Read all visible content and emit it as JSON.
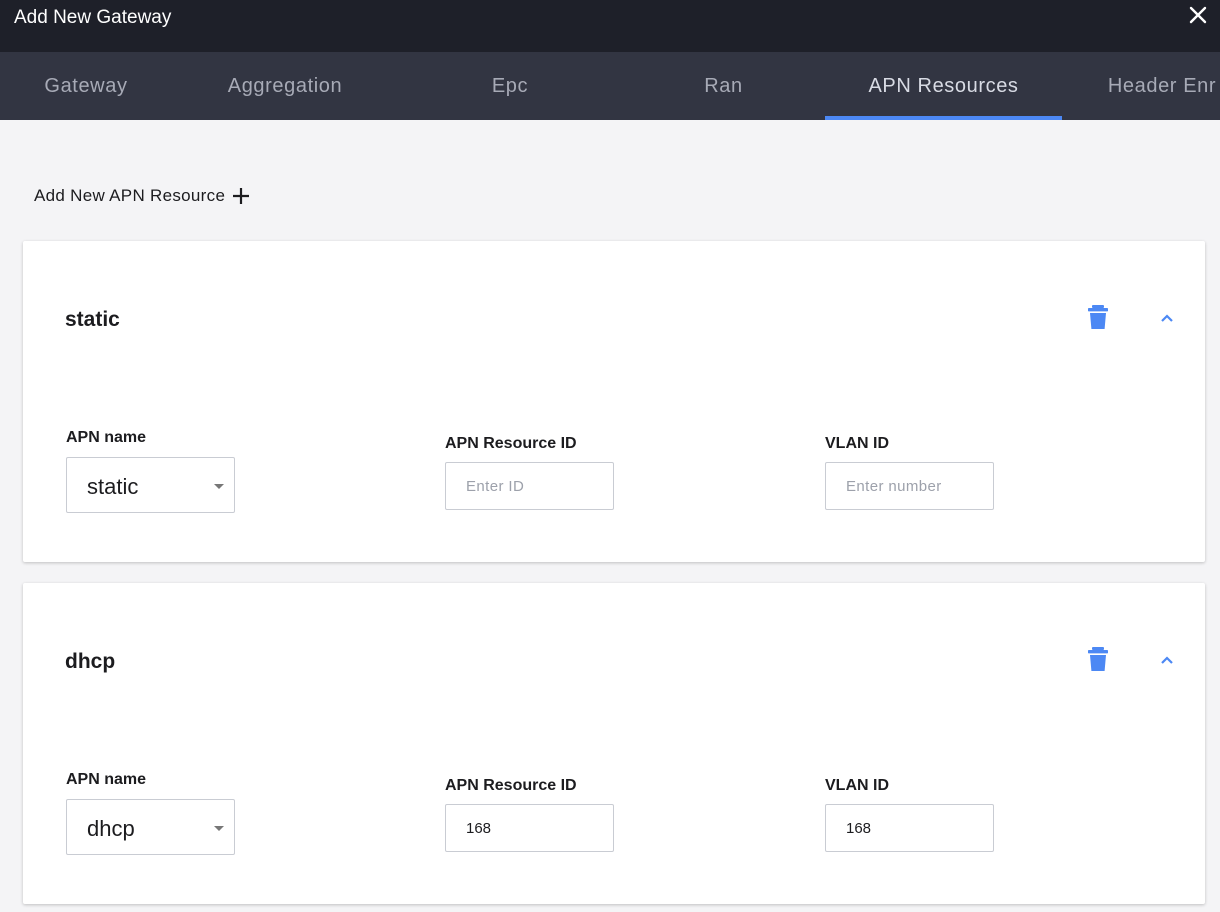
{
  "dialog": {
    "title": "Add New Gateway",
    "close_icon": "close-icon"
  },
  "tabs": [
    {
      "label": "Gateway",
      "active": false
    },
    {
      "label": "Aggregation",
      "active": false
    },
    {
      "label": "Epc",
      "active": false
    },
    {
      "label": "Ran",
      "active": false
    },
    {
      "label": "APN Resources",
      "active": true
    },
    {
      "label": "Header Enr",
      "active": false
    }
  ],
  "add_apn": {
    "label": "Add New APN Resource",
    "icon": "plus-icon"
  },
  "apn_resources": [
    {
      "title": "static",
      "apn_name_label": "APN name",
      "apn_name_value": "static",
      "resource_id_label": "APN Resource ID",
      "resource_id_value": "",
      "resource_id_placeholder": "Enter ID",
      "vlan_label": "VLAN ID",
      "vlan_value": "",
      "vlan_placeholder": "Enter number"
    },
    {
      "title": "dhcp",
      "apn_name_label": "APN name",
      "apn_name_value": "dhcp",
      "resource_id_label": "APN Resource ID",
      "resource_id_value": "168",
      "resource_id_placeholder": "",
      "vlan_label": "VLAN ID",
      "vlan_value": "168",
      "vlan_placeholder": ""
    }
  ],
  "colors": {
    "accent": "#4c88f4",
    "titlebar": "#1e2029",
    "tabbar": "#323542",
    "background": "#f4f4f6"
  }
}
